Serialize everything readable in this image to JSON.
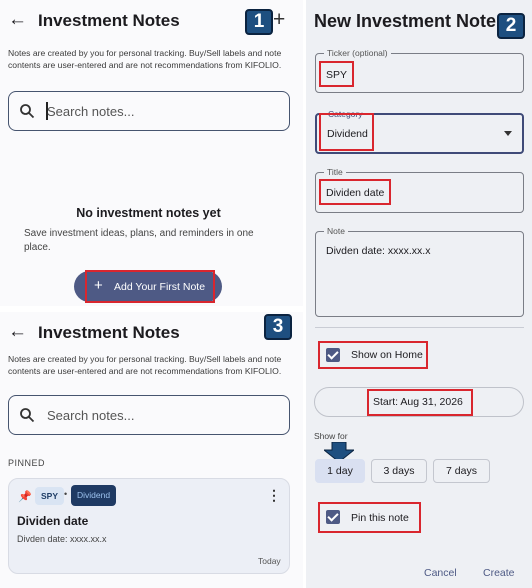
{
  "badges": [
    "1",
    "2",
    "3"
  ],
  "empty_screen": {
    "title": "Investment Notes",
    "back_icon": "arrow-left-icon",
    "add_icon": "plus-icon",
    "disclaimer": "Notes are created by you for personal tracking. Buy/Sell labels and note contents are user-entered and are not recommendations from KIFOLIO.",
    "search_placeholder": "Search notes...",
    "empty_title": "No investment notes yet",
    "empty_subtitle": "Save investment ideas, plans, and reminders in one place.",
    "add_button": "Add Your First Note"
  },
  "list_screen": {
    "title": "Investment Notes",
    "disclaimer": "Notes are created by you for personal tracking. Buy/Sell labels and note contents are user-entered and are not recommendations from KIFOLIO.",
    "search_placeholder": "Search notes...",
    "section_label": "PINNED",
    "note": {
      "ticker": "SPY",
      "separator": "•",
      "category": "Dividend",
      "title": "Dividen date",
      "body": "Divden date: xxxx.xx.x",
      "date": "Today"
    }
  },
  "new_note_dialog": {
    "title": "New Investment Note",
    "ticker_label": "Ticker (optional)",
    "ticker_value": "SPY",
    "category_label": "Category",
    "category_value": "Dividend",
    "title_label": "Title",
    "title_value": "Dividen date",
    "note_label": "Note",
    "note_value": "Divden date: xxxx.xx.x",
    "show_on_home": "Show on Home",
    "start_date": "Start: Aug 31, 2026",
    "show_for_label": "Show for",
    "show_for_options": [
      "1 day",
      "3 days",
      "7 days"
    ],
    "show_for_selected": "1 day",
    "pin_label": "Pin this note",
    "cancel": "Cancel",
    "create": "Create"
  },
  "colors": {
    "accent": "#4e5a85",
    "annotation_red": "#d9262e",
    "badge": "#1e4f80",
    "chip_dark": "#1f3a63"
  }
}
